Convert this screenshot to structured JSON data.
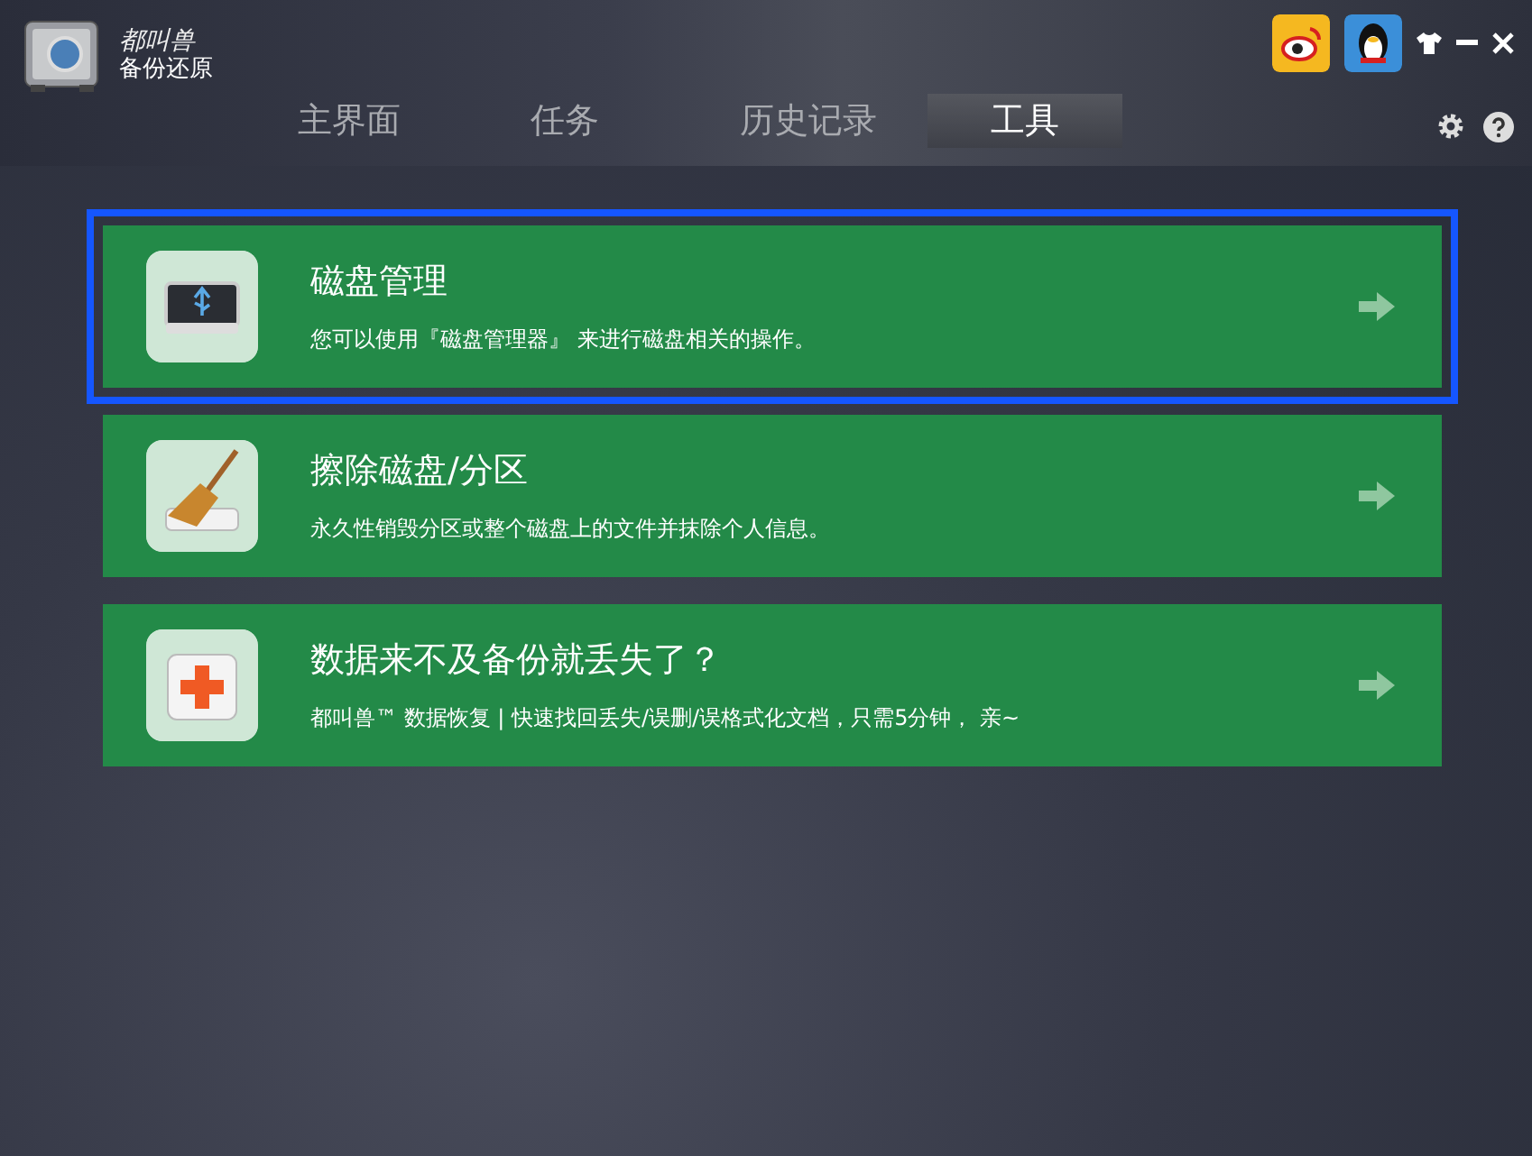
{
  "app": {
    "logo_text": "都叫兽",
    "title": "备份还原"
  },
  "tabs": [
    {
      "label": "主界面",
      "selected": false
    },
    {
      "label": "任务",
      "selected": false
    },
    {
      "label": "历史记录",
      "selected": false
    },
    {
      "label": "工具",
      "selected": true
    }
  ],
  "tools": [
    {
      "kind": "disk",
      "title": "磁盘管理",
      "description": "您可以使用『磁盘管理器』 来进行磁盘相关的操作。",
      "selected": true
    },
    {
      "kind": "wipe",
      "title": "擦除磁盘/分区",
      "description": "永久性销毁分区或整个磁盘上的文件并抹除个人信息。",
      "selected": false
    },
    {
      "kind": "recovery",
      "title": "数据来不及备份就丢失了？",
      "description": "都叫兽™ 数据恢复 | 快速找回丢失/误删/误格式化文档，只需5分钟， 亲~",
      "selected": false
    }
  ]
}
